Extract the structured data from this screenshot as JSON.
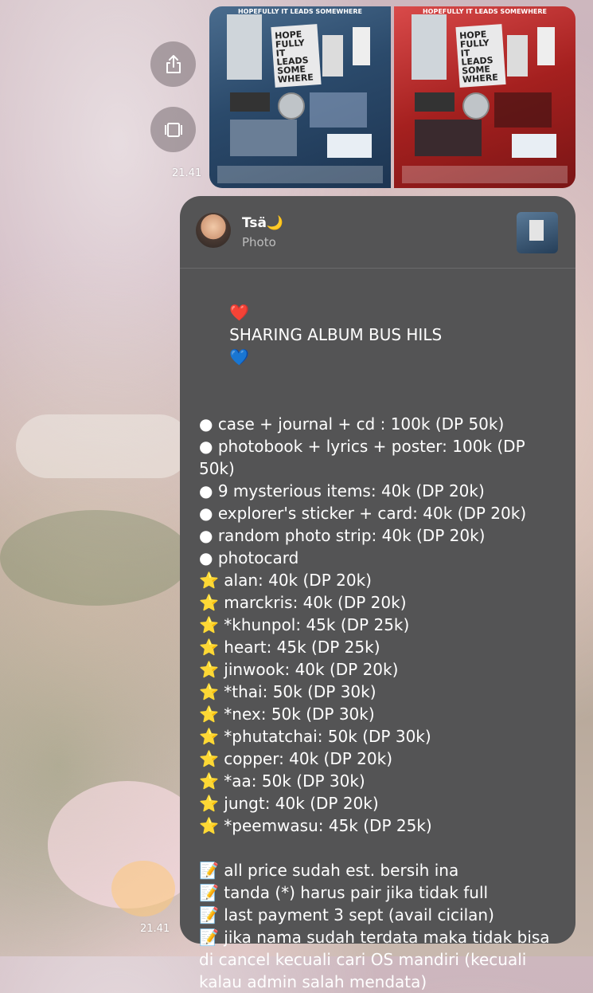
{
  "colors": {
    "bubble_bg": "#545455",
    "heart": "#e0262b",
    "blue_heart": "#2f7fff",
    "star": "#f6c42c"
  },
  "side_buttons": [
    {
      "name": "share",
      "icon": "share-icon"
    },
    {
      "name": "gallery",
      "icon": "gallery-icon"
    }
  ],
  "photo_message": {
    "time": "21.41",
    "images": [
      {
        "variant": "blue",
        "title": "HOPEFULLY IT LEADS SOMEWHERE",
        "cover": "HOPE FULLY IT LEADS SOME WHERE"
      },
      {
        "variant": "red",
        "title": "HOPEFULLY IT LEADS SOMEWHERE",
        "cover": "HOPE FULLY IT LEADS SOME WHERE"
      }
    ]
  },
  "reply": {
    "sender": "Tsä🌙",
    "type": "Photo"
  },
  "message": {
    "time": "21.41",
    "title": {
      "left_emoji": "❤️",
      "text": "SHARING ALBUM BUS HILS",
      "right_emoji": "💙"
    },
    "bullets": [
      "case + journal + cd : 100k (DP 50k)",
      "photobook + lyrics + poster: 100k (DP 50k)",
      "9 mysterious items: 40k (DP 20k)",
      "explorer's sticker + card: 40k (DP 20k)",
      "random photo strip: 40k (DP 20k)",
      "photocard"
    ],
    "photocards": [
      "alan: 40k (DP 20k)",
      "marckris: 40k (DP 20k)",
      "*khunpol: 45k (DP 25k)",
      "heart: 45k (DP 25k)",
      "jinwook: 40k (DP 20k)",
      "*thai: 50k (DP 30k)",
      "*nex: 50k (DP 30k)",
      "*phutatchai: 50k (DP 30k)",
      "copper: 40k (DP 20k)",
      "*aa: 50k (DP 30k)",
      "jungt: 40k (DP 20k)",
      "*peemwasu: 45k (DP 25k)"
    ],
    "notes": [
      "all price sudah est. bersih ina",
      "tanda (*) harus pair jika tidak full",
      "last payment 3 sept (avail cicilan)",
      "jika nama sudah terdata maka tidak bisa di cancel kecuali cari OS mandiri (kecuali kalau admin salah mendata)"
    ],
    "bullet_glyph": "●",
    "star_glyph": "⭐",
    "memo_glyph": "📝"
  }
}
